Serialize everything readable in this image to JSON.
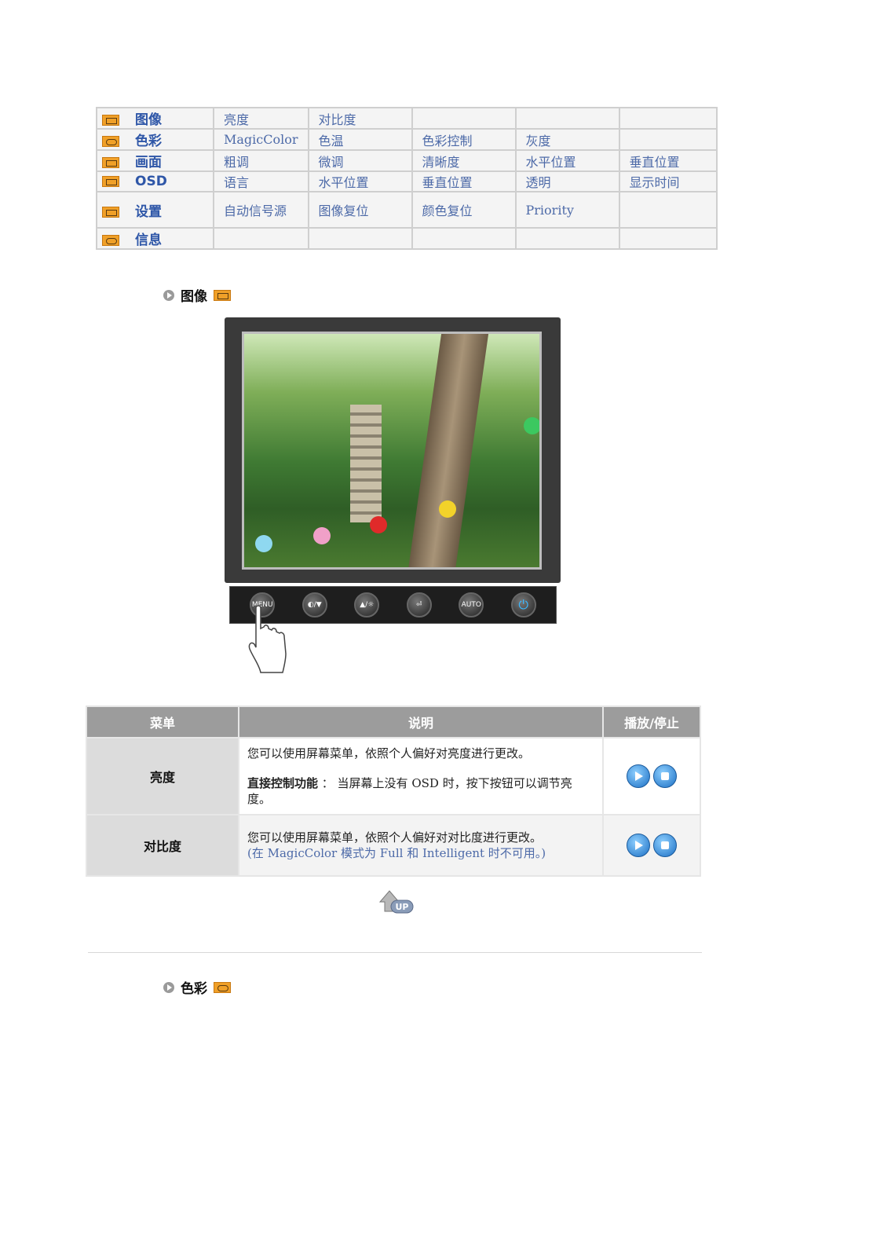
{
  "menu_grid": {
    "rows": [
      {
        "category": "图像",
        "icon": "picture-icon",
        "items": [
          "亮度",
          "对比度",
          "",
          "",
          ""
        ]
      },
      {
        "category": "色彩",
        "icon": "color-icon",
        "items": [
          "MagicColor",
          "色温",
          "色彩控制",
          "灰度",
          ""
        ]
      },
      {
        "category": "画面",
        "icon": "image-icon",
        "items": [
          "粗调",
          "微调",
          "清晰度",
          "水平位置",
          "垂直位置"
        ]
      },
      {
        "category": "OSD",
        "icon": "osd-icon",
        "items": [
          "语言",
          "水平位置",
          "垂直位置",
          "透明",
          "显示时间"
        ]
      },
      {
        "category": "设置",
        "icon": "setup-icon",
        "items": [
          "自动信号源",
          "图像复位",
          "颜色复位",
          "Priority",
          ""
        ]
      },
      {
        "category": "信息",
        "icon": "info-icon",
        "items": [
          "",
          "",
          "",
          "",
          ""
        ]
      }
    ]
  },
  "section_picture": {
    "title": "图像",
    "icon": "picture-icon"
  },
  "control_bar": {
    "buttons": [
      {
        "name": "menu-button",
        "label": "MENU"
      },
      {
        "name": "magicbright-button",
        "label": "◐/▼"
      },
      {
        "name": "brightness-button",
        "label": "▲/☼"
      },
      {
        "name": "enter-button",
        "label": "⏎"
      },
      {
        "name": "auto-button",
        "label": "AUTO"
      },
      {
        "name": "power-button",
        "label": "⏻"
      }
    ]
  },
  "desc_table": {
    "headers": {
      "menu": "菜单",
      "description": "说明",
      "play": "播放/停止"
    },
    "rows": [
      {
        "menu": "亮度",
        "line1": "您可以使用屏幕菜单，依照个人偏好对亮度进行更改。",
        "direct_label": "直接控制功能",
        "direct_text": " ： 当屏幕上没有 OSD 时，按下按钮可以调节亮度。"
      },
      {
        "menu": "对比度",
        "line1": "您可以使用屏幕菜单，依照个人偏好对对比度进行更改。",
        "note": "(在 MagicColor 模式为 Full 和 Intelligent 时不可用。)"
      }
    ]
  },
  "up_button": {
    "label": "UP"
  },
  "section_color": {
    "title": "色彩",
    "icon": "color-icon"
  },
  "colors": {
    "link": "#4d6aa8",
    "category": "#2f57a8",
    "header_bg": "#9c9c9c",
    "icon_orange": "#f0a028"
  }
}
